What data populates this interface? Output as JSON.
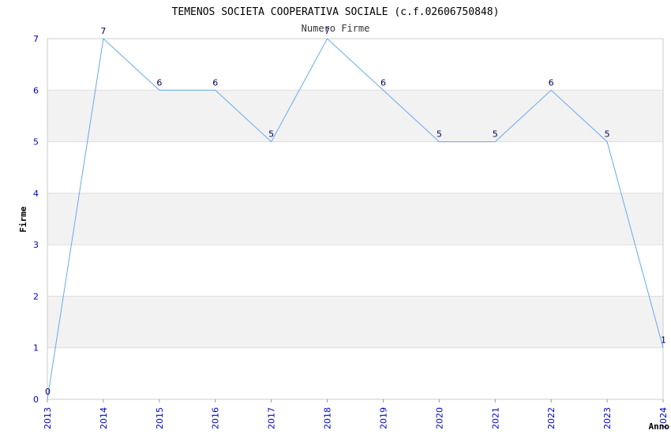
{
  "chart_data": {
    "type": "line",
    "title": "TEMENOS SOCIETA COOPERATIVA SOCIALE (c.f.02606750848)",
    "subtitle": "Numero Firme",
    "xlabel": "Anno",
    "ylabel": "Firme",
    "x": [
      "2013",
      "2014",
      "2015",
      "2016",
      "2017",
      "2018",
      "2019",
      "2020",
      "2021",
      "2022",
      "2023",
      "2024"
    ],
    "series": [
      {
        "values": [
          0,
          7,
          6,
          6,
          5,
          7,
          6,
          5,
          5,
          6,
          5,
          1
        ]
      }
    ],
    "ylim": [
      0,
      7
    ],
    "yticks": [
      "0",
      "1",
      "2",
      "3",
      "4",
      "5",
      "6",
      "7"
    ],
    "grid": "horizontal bands",
    "colors": {
      "line": "#66aaee",
      "band": "#f2f2f2",
      "tick_text": "#0000cc",
      "data_label": "#000066"
    }
  }
}
